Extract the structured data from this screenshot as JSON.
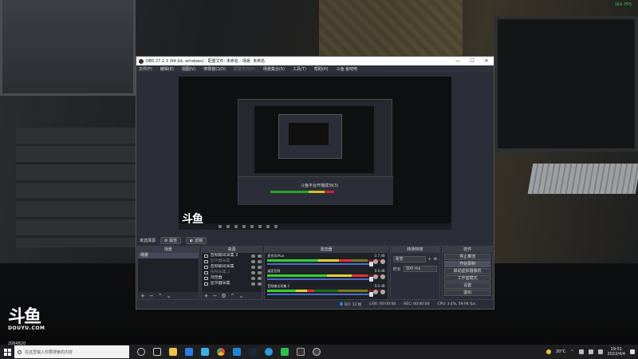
{
  "overlay": {
    "fps": "164 FPS"
  },
  "douyu": {
    "glyph": "斗鱼",
    "word": "DOUYU.COM",
    "room_id": "2064820"
  },
  "obs": {
    "title": "OBS 27.2.3 (64 bit, windows) - 配置文件: 未命名 - 场景: 未命名",
    "menu": [
      "文件(F)",
      "编辑(E)",
      "视图(V)",
      "停靠窗口(D)",
      "配置文件(P)",
      "场景集合(S)",
      "工具(T)",
      "帮助(H)",
      "斗鱼·鱼吧吧"
    ],
    "preview": {
      "nested_text": "斗鱼平台开播成功(3)",
      "logo": "斗鱼"
    },
    "scene_bar": {
      "label": "未选择源",
      "properties": "属性",
      "filters": "滤镜"
    },
    "docks": {
      "scenes": {
        "title": "场景",
        "items": [
          "场景"
        ]
      },
      "sources": {
        "title": "来源",
        "items": [
          {
            "name": "音频输出采集 2",
            "disabled": false
          },
          {
            "name": "显示器采集",
            "disabled": true
          },
          {
            "name": "音频输出采集",
            "disabled": false
          },
          {
            "name": "视频采集 2",
            "disabled": true
          },
          {
            "name": "浏览器",
            "disabled": false
          },
          {
            "name": "显示器采集",
            "disabled": false
          }
        ]
      },
      "mixer": {
        "title": "混音器",
        "channels": [
          {
            "name": "麦克风/Aux",
            "db": "-2.7 dB",
            "level": 0.72
          },
          {
            "name": "桌面音频",
            "db": "0.0 dB",
            "level": 0.85
          },
          {
            "name": "音频输出采集 2",
            "db": "0.0 dB",
            "level": 0.4
          }
        ]
      },
      "transitions": {
        "title": "转场特效",
        "type": "渐变",
        "duration_label": "时长",
        "duration": "300 ms"
      },
      "controls": {
        "title": "控件",
        "buttons": [
          "停止推流",
          "开始录制",
          "启动虚拟摄像机",
          "工作室模式",
          "设置",
          "退出"
        ]
      }
    },
    "status": {
      "dropped": "DO: 12 帧",
      "live": "LIVE: 00:00:00",
      "rec": "REC: 00:00:00",
      "cpu": "CPU: 3.4%, 59.94 fps"
    }
  },
  "taskbar": {
    "search_placeholder": "在这里输入你要搜索的内容",
    "weather": "20°C",
    "time": "19:51",
    "date": "2022/4/4"
  }
}
